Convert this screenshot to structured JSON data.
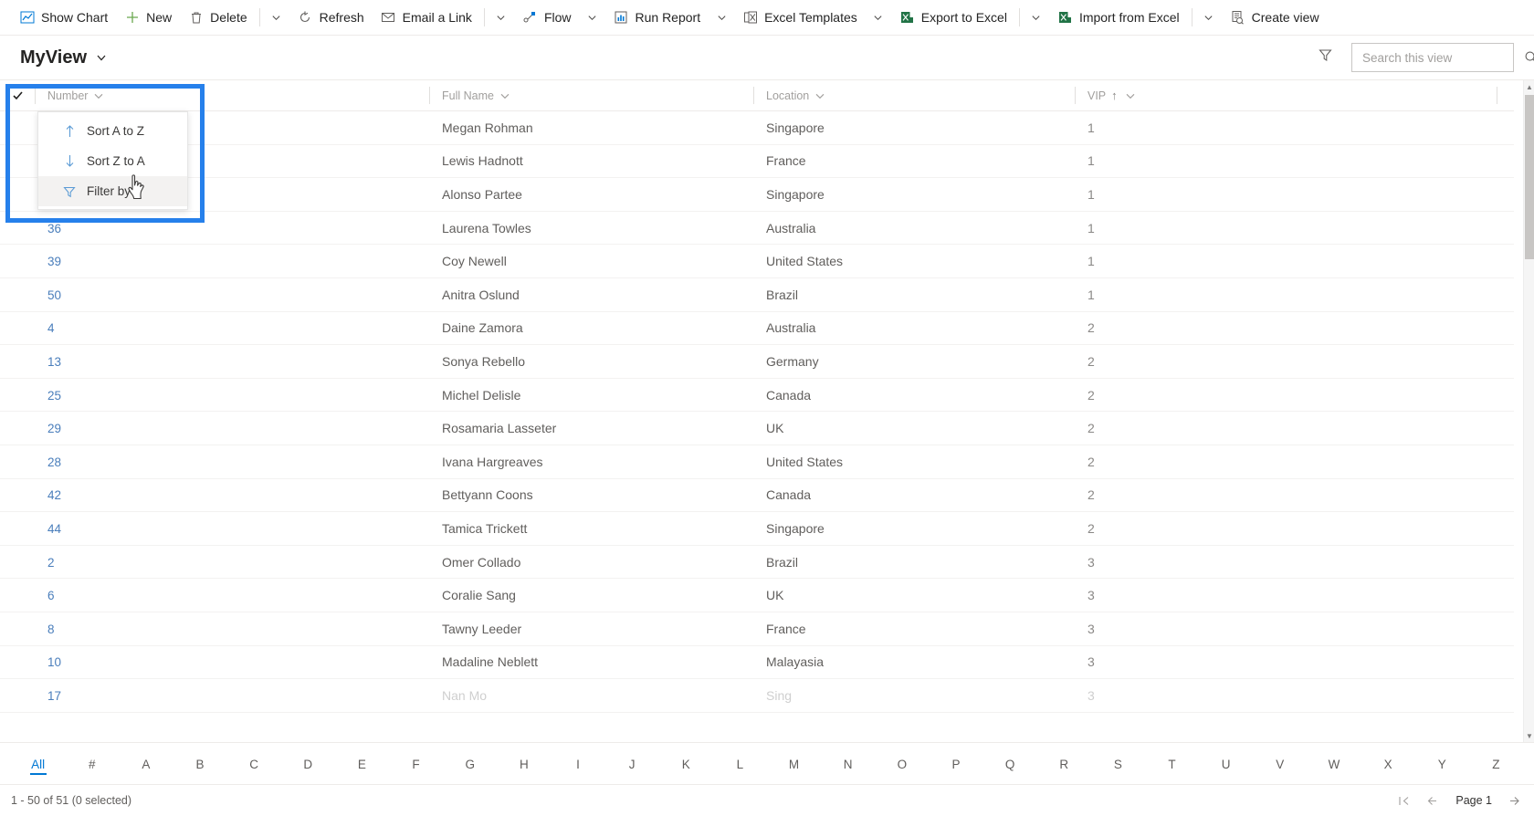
{
  "commandbar": {
    "items": [
      {
        "label": "Show Chart",
        "icon": "show-chart-icon",
        "caret": false
      },
      {
        "label": "New",
        "icon": "plus-icon",
        "caret": false
      },
      {
        "label": "Delete",
        "icon": "trash-icon",
        "caret": true
      },
      {
        "label": "Refresh",
        "icon": "refresh-icon",
        "caret": false
      },
      {
        "label": "Email a Link",
        "icon": "email-link-icon",
        "caret": true
      },
      {
        "label": "Flow",
        "icon": "flow-icon",
        "caret": true
      },
      {
        "label": "Run Report",
        "icon": "run-report-icon",
        "caret": true
      },
      {
        "label": "Excel Templates",
        "icon": "excel-templates-icon",
        "caret": true
      },
      {
        "label": "Export to Excel",
        "icon": "export-excel-icon",
        "caret": true
      },
      {
        "label": "Import from Excel",
        "icon": "import-excel-icon",
        "caret": true
      },
      {
        "label": "Create view",
        "icon": "create-view-icon",
        "caret": false
      }
    ]
  },
  "header": {
    "view_name": "MyView",
    "filter_tooltip": "Filter",
    "search": {
      "placeholder": "Search this view",
      "value": ""
    }
  },
  "grid": {
    "columns": [
      {
        "key": "check",
        "label": ""
      },
      {
        "key": "number",
        "label": "Number",
        "sort": ""
      },
      {
        "key": "fullname",
        "label": "Full Name",
        "sort": ""
      },
      {
        "key": "location",
        "label": "Location",
        "sort": ""
      },
      {
        "key": "vip",
        "label": "VIP",
        "sort": "ascending"
      }
    ],
    "rows": [
      {
        "number": "",
        "fullname": "Megan Rohman",
        "location": "Singapore",
        "vip": "1"
      },
      {
        "number": "",
        "fullname": "Lewis Hadnott",
        "location": "France",
        "vip": "1"
      },
      {
        "number": "",
        "fullname": "Alonso Partee",
        "location": "Singapore",
        "vip": "1"
      },
      {
        "number": "36",
        "fullname": "Laurena Towles",
        "location": "Australia",
        "vip": "1"
      },
      {
        "number": "39",
        "fullname": "Coy Newell",
        "location": "United States",
        "vip": "1"
      },
      {
        "number": "50",
        "fullname": "Anitra Oslund",
        "location": "Brazil",
        "vip": "1"
      },
      {
        "number": "4",
        "fullname": "Daine Zamora",
        "location": "Australia",
        "vip": "2"
      },
      {
        "number": "13",
        "fullname": "Sonya Rebello",
        "location": "Germany",
        "vip": "2"
      },
      {
        "number": "25",
        "fullname": "Michel Delisle",
        "location": "Canada",
        "vip": "2"
      },
      {
        "number": "29",
        "fullname": "Rosamaria Lasseter",
        "location": "UK",
        "vip": "2"
      },
      {
        "number": "28",
        "fullname": "Ivana Hargreaves",
        "location": "United States",
        "vip": "2"
      },
      {
        "number": "42",
        "fullname": "Bettyann Coons",
        "location": "Canada",
        "vip": "2"
      },
      {
        "number": "44",
        "fullname": "Tamica Trickett",
        "location": "Singapore",
        "vip": "2"
      },
      {
        "number": "2",
        "fullname": "Omer Collado",
        "location": "Brazil",
        "vip": "3"
      },
      {
        "number": "6",
        "fullname": "Coralie Sang",
        "location": "UK",
        "vip": "3"
      },
      {
        "number": "8",
        "fullname": "Tawny Leeder",
        "location": "France",
        "vip": "3"
      },
      {
        "number": "10",
        "fullname": "Madaline Neblett",
        "location": "Malayasia",
        "vip": "3"
      },
      {
        "number": "17",
        "fullname": "Nan Mo",
        "location": "Sing",
        "vip": "3"
      }
    ]
  },
  "column_menu": {
    "items": [
      {
        "label": "Sort A to Z",
        "icon": "arrow-up-icon",
        "hover": false
      },
      {
        "label": "Sort Z to A",
        "icon": "arrow-down-icon",
        "hover": false
      },
      {
        "label": "Filter by",
        "icon": "funnel-icon",
        "hover": true
      }
    ]
  },
  "alphabar": {
    "items": [
      "All",
      "#",
      "A",
      "B",
      "C",
      "D",
      "E",
      "F",
      "G",
      "H",
      "I",
      "J",
      "K",
      "L",
      "M",
      "N",
      "O",
      "P",
      "Q",
      "R",
      "S",
      "T",
      "U",
      "V",
      "W",
      "X",
      "Y",
      "Z"
    ],
    "selected": "All"
  },
  "footer": {
    "status": "1 - 50 of 51 (0 selected)",
    "page_label": "Page 1",
    "first_icon": "first-page-icon",
    "prev_icon": "prev-page-icon",
    "next_icon": "next-page-icon"
  },
  "colors": {
    "accent": "#0078d4",
    "highlight_box": "#2680eb",
    "link": "#4a7ebb",
    "excel_green": "#217346"
  }
}
